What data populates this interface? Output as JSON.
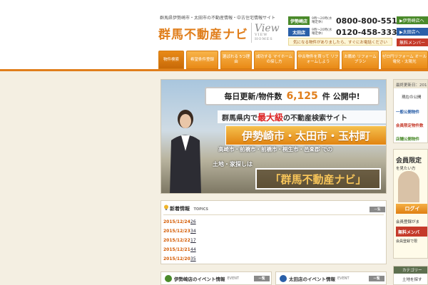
{
  "header": {
    "tagline": "群馬県伊勢崎市・太田市の不動産情報・中古住宅情報サイト",
    "logo": "群馬不動産ナビ",
    "view_logo": "View",
    "view_logo_sub": "VIEW HOMES",
    "stores": [
      {
        "name": "伊勢崎店",
        "hours": "9時～20時(水曜定休)",
        "phone": "0800-800-5515",
        "color": "#4a8a2a"
      },
      {
        "name": "太田店",
        "hours": "9時～20時(水曜定休)",
        "phone": "0120-458-333",
        "color": "#2a5fa8"
      }
    ],
    "notice": "気になる物件がありましたら、すぐにお電話ください",
    "side_buttons": [
      {
        "label": "▶伊勢崎店へ",
        "color": "#4a8a2a"
      },
      {
        "label": "▶太田店へ",
        "color": "#2a5fa8"
      },
      {
        "label": "無料メンバー",
        "color": "#c53a2a"
      }
    ]
  },
  "nav": {
    "tabs": [
      "物件検索",
      "希望条件登録",
      "選ばれる 5つ理由",
      "成功する マイホームの探し方",
      "中古物件を買って リフォームしよう",
      "お薦め リフォームプラン",
      "ゼロ円リフォーム オール電化・太陽光"
    ]
  },
  "banner": {
    "counter_prefix": "毎日更新/物件数",
    "counter_value": "6,125",
    "counter_suffix": "件 公開中!",
    "strip_pre": "群馬県内で",
    "strip_red": "最大級",
    "strip_post": "の不動産検索サイト",
    "cities": "伊勢崎市・太田市・玉村町",
    "sub_cities": "高崎市・前橋市・前橋市・桐生市・邑楽郡 での",
    "search_text": "土地・家探しは",
    "brand": "「群馬不動産ナビ」"
  },
  "news": {
    "title": "新着情報",
    "title_en": "TOPICS",
    "more": "一覧",
    "items": [
      {
        "date": "2015/12/24",
        "link": "26"
      },
      {
        "date": "2015/12/23",
        "link": "34"
      },
      {
        "date": "2015/12/22",
        "link": "17"
      },
      {
        "date": "2015/12/21",
        "link": "44"
      },
      {
        "date": "2015/12/20",
        "link": "35"
      }
    ]
  },
  "events": [
    {
      "title": "伊勢崎店のイベント情報",
      "en": "EVENT",
      "more": "一覧",
      "color": "#4a8a2a"
    },
    {
      "title": "太田店のイベント情報",
      "en": "EVENT",
      "more": "一覧",
      "color": "#2a5fa8"
    }
  ],
  "right_col": {
    "updated_label": "最終更新日：201",
    "public_label": "現在の公開",
    "general": "一般公開物件",
    "member": "会員限定物件数",
    "store": "店舗公開物件",
    "member_box_title": "会員限定",
    "member_box_sub": "を見たい方",
    "login": "ログイ",
    "member_reg": "会員登録がま",
    "free_member": "無料メンバ",
    "free_member_sub": "会員登録で限",
    "category": "カテゴリー",
    "category_item": "土地を探す"
  }
}
